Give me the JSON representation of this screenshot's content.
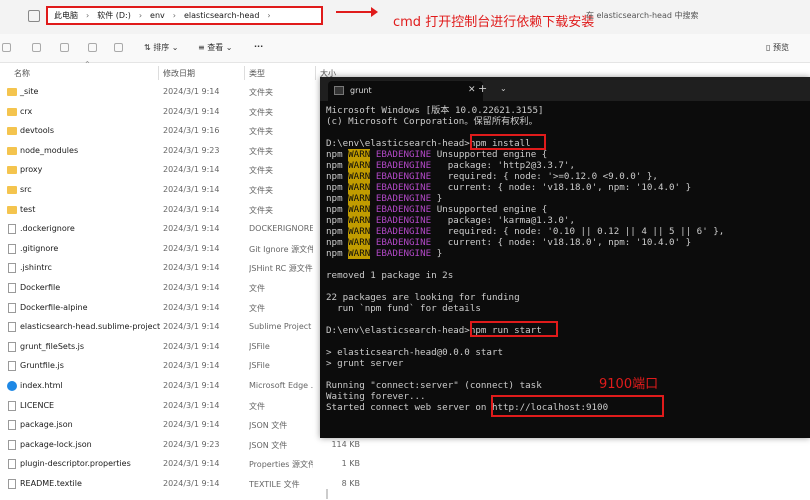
{
  "address": {
    "crumbs": [
      "此电脑",
      "软件 (D:)",
      "env",
      "elasticsearch-head"
    ]
  },
  "annotation_top": "cmd 打开控制台进行依赖下载安装",
  "search_placeholder": "在 elasticsearch-head 中搜索",
  "toolbar": {
    "sort_label": "排序",
    "view_label": "查看",
    "more_label": "···",
    "details_label": "预览"
  },
  "columns": {
    "name": "名称",
    "date": "修改日期",
    "type": "类型",
    "size": "大小"
  },
  "files": [
    {
      "name": "_site",
      "date": "2024/3/1 9:14",
      "type": "文件夹",
      "size": "",
      "icon": "folder"
    },
    {
      "name": "crx",
      "date": "2024/3/1 9:14",
      "type": "文件夹",
      "size": "",
      "icon": "folder"
    },
    {
      "name": "devtools",
      "date": "2024/3/1 9:16",
      "type": "文件夹",
      "size": "",
      "icon": "folder"
    },
    {
      "name": "node_modules",
      "date": "2024/3/1 9:23",
      "type": "文件夹",
      "size": "",
      "icon": "folder"
    },
    {
      "name": "proxy",
      "date": "2024/3/1 9:14",
      "type": "文件夹",
      "size": "",
      "icon": "folder"
    },
    {
      "name": "src",
      "date": "2024/3/1 9:14",
      "type": "文件夹",
      "size": "",
      "icon": "folder"
    },
    {
      "name": "test",
      "date": "2024/3/1 9:14",
      "type": "文件夹",
      "size": "",
      "icon": "folder"
    },
    {
      "name": ".dockerignore",
      "date": "2024/3/1 9:14",
      "type": "DOCKERIGNORE...",
      "size": "",
      "icon": "file"
    },
    {
      "name": ".gitignore",
      "date": "2024/3/1 9:14",
      "type": "Git Ignore 源文件",
      "size": "",
      "icon": "file"
    },
    {
      "name": ".jshintrc",
      "date": "2024/3/1 9:14",
      "type": "JSHint RC 源文件",
      "size": "",
      "icon": "file"
    },
    {
      "name": "Dockerfile",
      "date": "2024/3/1 9:14",
      "type": "文件",
      "size": "",
      "icon": "file"
    },
    {
      "name": "Dockerfile-alpine",
      "date": "2024/3/1 9:14",
      "type": "文件",
      "size": "",
      "icon": "file"
    },
    {
      "name": "elasticsearch-head.sublime-project",
      "date": "2024/3/1 9:14",
      "type": "Sublime Project",
      "size": "",
      "icon": "file"
    },
    {
      "name": "grunt_fileSets.js",
      "date": "2024/3/1 9:14",
      "type": "JSFile",
      "size": "",
      "icon": "file"
    },
    {
      "name": "Gruntfile.js",
      "date": "2024/3/1 9:14",
      "type": "JSFile",
      "size": "",
      "icon": "file"
    },
    {
      "name": "index.html",
      "date": "2024/3/1 9:14",
      "type": "Microsoft Edge ...",
      "size": "",
      "icon": "edge"
    },
    {
      "name": "LICENCE",
      "date": "2024/3/1 9:14",
      "type": "文件",
      "size": "",
      "icon": "file"
    },
    {
      "name": "package.json",
      "date": "2024/3/1 9:14",
      "type": "JSON 文件",
      "size": "",
      "icon": "file"
    },
    {
      "name": "package-lock.json",
      "date": "2024/3/1 9:23",
      "type": "JSON 文件",
      "size": "114 KB",
      "icon": "file"
    },
    {
      "name": "plugin-descriptor.properties",
      "date": "2024/3/1 9:14",
      "type": "Properties 源文件",
      "size": "1 KB",
      "icon": "file"
    },
    {
      "name": "README.textile",
      "date": "2024/3/1 9:14",
      "type": "TEXTILE 文件",
      "size": "8 KB",
      "icon": "file"
    }
  ],
  "terminal": {
    "tab_title": "grunt",
    "lines": [
      "Microsoft Windows [版本 10.0.22621.3155]",
      "(c) Microsoft Corporation。保留所有权利。",
      "",
      "D:\\env\\elasticsearch-head>npm install",
      "npm WARN EBADENGINE Unsupported engine {",
      "npm WARN EBADENGINE   package: 'http2@3.3.7',",
      "npm WARN EBADENGINE   required: { node: '>=0.12.0 <9.0.0' },",
      "npm WARN EBADENGINE   current: { node: 'v18.18.0', npm: '10.4.0' }",
      "npm WARN EBADENGINE }",
      "npm WARN EBADENGINE Unsupported engine {",
      "npm WARN EBADENGINE   package: 'karma@1.3.0',",
      "npm WARN EBADENGINE   required: { node: '0.10 || 0.12 || 4 || 5 || 6' },",
      "npm WARN EBADENGINE   current: { node: 'v18.18.0', npm: '10.4.0' }",
      "npm WARN EBADENGINE }",
      "",
      "removed 1 package in 2s",
      "",
      "22 packages are looking for funding",
      "  run `npm fund` for details",
      "",
      "D:\\env\\elasticsearch-head>npm run start",
      "",
      "> elasticsearch-head@0.0.0 start",
      "> grunt server",
      "",
      "Running \"connect:server\" (connect) task",
      "Waiting forever...",
      "Started connect web server on http://localhost:9100"
    ]
  },
  "annotation_port": "9100端口"
}
